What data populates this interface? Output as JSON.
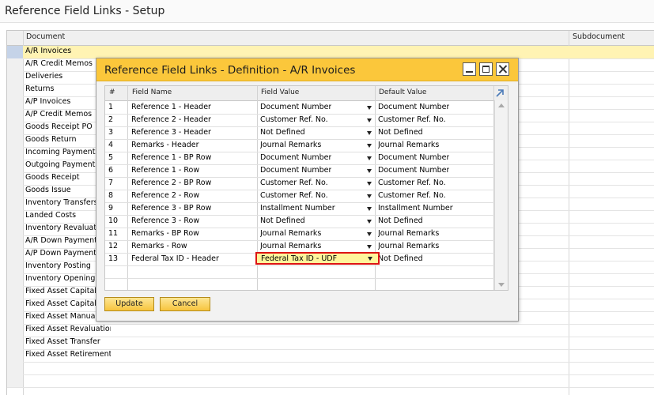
{
  "window": {
    "title": "Reference Field Links - Setup"
  },
  "setup_grid": {
    "columns": {
      "document": "Document",
      "subdocument": "Subdocument"
    },
    "rows": [
      "A/R Invoices",
      "A/R Credit Memos",
      "Deliveries",
      "Returns",
      "A/P Invoices",
      "A/P Credit Memos",
      "Goods Receipt PO",
      "Goods Return",
      "Incoming Payments",
      "Outgoing Payments",
      "Goods Receipt",
      "Goods Issue",
      "Inventory Transfers",
      "Landed Costs",
      "Inventory Revaluation",
      "A/R Down Payment",
      "A/P Down Payment",
      "Inventory Posting",
      "Inventory Opening",
      "Fixed Asset Capitalization",
      "Fixed Asset Capitalization",
      "Fixed Asset Manual",
      "Fixed Asset Revaluation",
      "Fixed Asset Transfer",
      "Fixed Asset Retirement"
    ],
    "selected_index": 0
  },
  "dialog": {
    "title": "Reference Field Links - Definition - A/R Invoices",
    "columns": {
      "num": "#",
      "field_name": "Field Name",
      "field_value": "Field Value",
      "default_value": "Default Value"
    },
    "rows": [
      {
        "num": "1",
        "field_name": "Reference 1 - Header",
        "field_value": "Document Number",
        "default_value": "Document Number"
      },
      {
        "num": "2",
        "field_name": "Reference 2 - Header",
        "field_value": "Customer Ref. No.",
        "default_value": "Customer Ref. No."
      },
      {
        "num": "3",
        "field_name": "Reference 3 - Header",
        "field_value": "Not Defined",
        "default_value": "Not Defined"
      },
      {
        "num": "4",
        "field_name": "Remarks - Header",
        "field_value": "Journal Remarks",
        "default_value": "Journal Remarks"
      },
      {
        "num": "5",
        "field_name": "Reference 1 - BP Row",
        "field_value": "Document Number",
        "default_value": "Document Number"
      },
      {
        "num": "6",
        "field_name": "Reference 1 - Row",
        "field_value": "Document Number",
        "default_value": "Document Number"
      },
      {
        "num": "7",
        "field_name": "Reference 2 - BP Row",
        "field_value": "Customer Ref. No.",
        "default_value": "Customer Ref. No."
      },
      {
        "num": "8",
        "field_name": "Reference 2 - Row",
        "field_value": "Customer Ref. No.",
        "default_value": "Customer Ref. No."
      },
      {
        "num": "9",
        "field_name": "Reference 3 - BP Row",
        "field_value": "Installment Number",
        "default_value": "Installment Number"
      },
      {
        "num": "10",
        "field_name": "Reference 3 - Row",
        "field_value": "Not Defined",
        "default_value": "Not Defined"
      },
      {
        "num": "11",
        "field_name": "Remarks - BP Row",
        "field_value": "Journal Remarks",
        "default_value": "Journal Remarks"
      },
      {
        "num": "12",
        "field_name": "Remarks - Row",
        "field_value": "Journal Remarks",
        "default_value": "Journal Remarks"
      },
      {
        "num": "13",
        "field_name": "Federal Tax ID - Header",
        "field_value": "Federal Tax ID - UDF",
        "default_value": "Not Defined"
      }
    ],
    "highlighted_row": 13,
    "buttons": {
      "update": "Update",
      "cancel": "Cancel"
    }
  },
  "colors": {
    "accent": "#fbc73b",
    "selection": "#fff3b3",
    "highlight_border": "#dd1414"
  }
}
